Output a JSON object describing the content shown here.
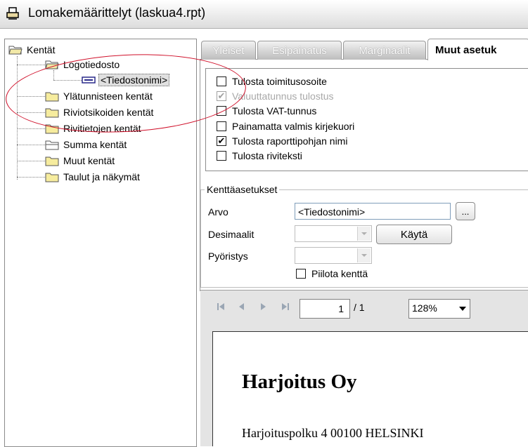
{
  "window": {
    "title": "Lomakemäärittelyt (laskua4.rpt)"
  },
  "tree": {
    "root": "Kentät",
    "items": [
      {
        "label": "Logotiedosto",
        "child": "<Tiedostonimi>"
      },
      {
        "label": "Ylätunnisteen kentät"
      },
      {
        "label": "Riviotsikoiden kentät"
      },
      {
        "label": "Rivitietojen kentät"
      },
      {
        "label": "Summa kentät"
      },
      {
        "label": "Muut kentät"
      },
      {
        "label": "Taulut ja näkymät"
      }
    ]
  },
  "tabs": [
    "Yleiset",
    "Esipainatus",
    "Marginaalit",
    "Muut asetuk"
  ],
  "options": [
    {
      "label": "Tulosta toimitusosoite",
      "checked": false,
      "enabled": true
    },
    {
      "label": "Valuuttatunnus tulostus",
      "checked": true,
      "enabled": false
    },
    {
      "label": "Tulosta VAT-tunnus",
      "checked": false,
      "enabled": true
    },
    {
      "label": "Painamatta valmis kirjekuori",
      "checked": false,
      "enabled": true
    },
    {
      "label": "Tulosta raporttipohjan nimi",
      "checked": true,
      "enabled": true
    },
    {
      "label": "Tulosta riviteksti",
      "checked": false,
      "enabled": true
    }
  ],
  "field_settings": {
    "title": "Kenttäasetukset",
    "arvo_label": "Arvo",
    "arvo_value": "<Tiedostonimi>",
    "browse_label": "...",
    "desimaalit_label": "Desimaalit",
    "apply_label": "Käytä",
    "pyoristys_label": "Pyöristys",
    "hide_label": "Piilota kenttä"
  },
  "viewer": {
    "page_current": "1",
    "page_total": "/ 1",
    "zoom": "128%",
    "doc_title": "Harjoitus Oy",
    "doc_address": "Harjoituspolku 4 00100 HELSINKI"
  },
  "colors": {
    "annotation_ellipse": "#d0102a",
    "input_border": "#7f9db9"
  }
}
